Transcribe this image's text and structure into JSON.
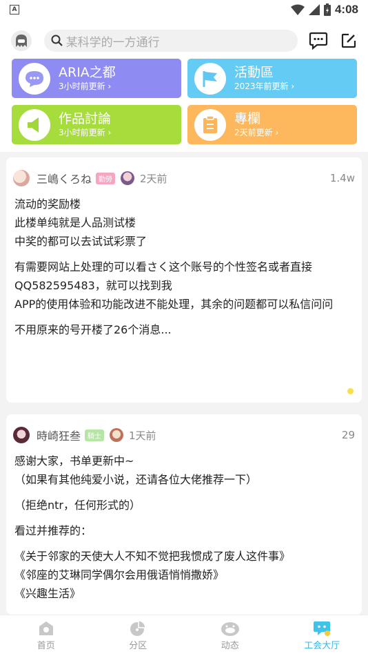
{
  "status": {
    "time": "4:08",
    "app_badge": "A"
  },
  "search": {
    "placeholder": "某科学的一方通行"
  },
  "forums": [
    {
      "title": "ARIA之都",
      "sub": "3小时前更新 ›",
      "color": "#8e8cf3",
      "icon": "chat-bubble-icon"
    },
    {
      "title": "活動區",
      "sub": "2023年前更新 ›",
      "color": "#64ccf4",
      "icon": "flag-icon"
    },
    {
      "title": "作品討論",
      "sub": "3小时前更新 ›",
      "color": "#a6dc3c",
      "icon": "speaker-icon"
    },
    {
      "title": "專欄",
      "sub": "2天前更新 ›",
      "color": "#fdb75d",
      "icon": "clipboard-icon"
    }
  ],
  "posts": [
    {
      "author": "三嶋くろね",
      "badge": "勤勞",
      "badge_color": "#f4a6c3",
      "time": "2天前",
      "count": "1.4w",
      "paragraphs": [
        [
          "流动的奖励楼",
          "此楼单纯就是人品测试楼",
          "中奖的都可以去试试彩票了"
        ],
        [
          "有需要网站上处理的可以看さく这个账号的个性签名或者直接QQ582595483，就可以找到我",
          "APP的使用体验和功能改进不能处理，其余的问题都可以私信问问"
        ],
        [
          "不用原来的号开楼了26个消息..."
        ]
      ]
    },
    {
      "author": "時崎狂叁",
      "badge": "騎士",
      "badge_color": "#b6e6a6",
      "time": "1天前",
      "count": "29",
      "paragraphs": [
        [
          "感谢大家，书单更新中~",
          "（如果有其他纯爱小说，还请各位大佬推荐一下）"
        ],
        [
          "（拒绝ntr，任何形式的）"
        ],
        [
          "看过并推荐的："
        ],
        [
          "《关于邻家的天使大人不知不觉把我惯成了废人这件事》",
          "《邻座的艾琳同学偶尔会用俄语悄悄撒娇》",
          "《兴趣生活》"
        ]
      ]
    }
  ],
  "tabs": [
    {
      "label": "首页",
      "icon": "home-icon"
    },
    {
      "label": "分区",
      "icon": "pie-chart-icon"
    },
    {
      "label": "动态",
      "icon": "bean-face-icon"
    },
    {
      "label": "工会大厅",
      "icon": "guild-chat-icon",
      "active": true
    }
  ]
}
